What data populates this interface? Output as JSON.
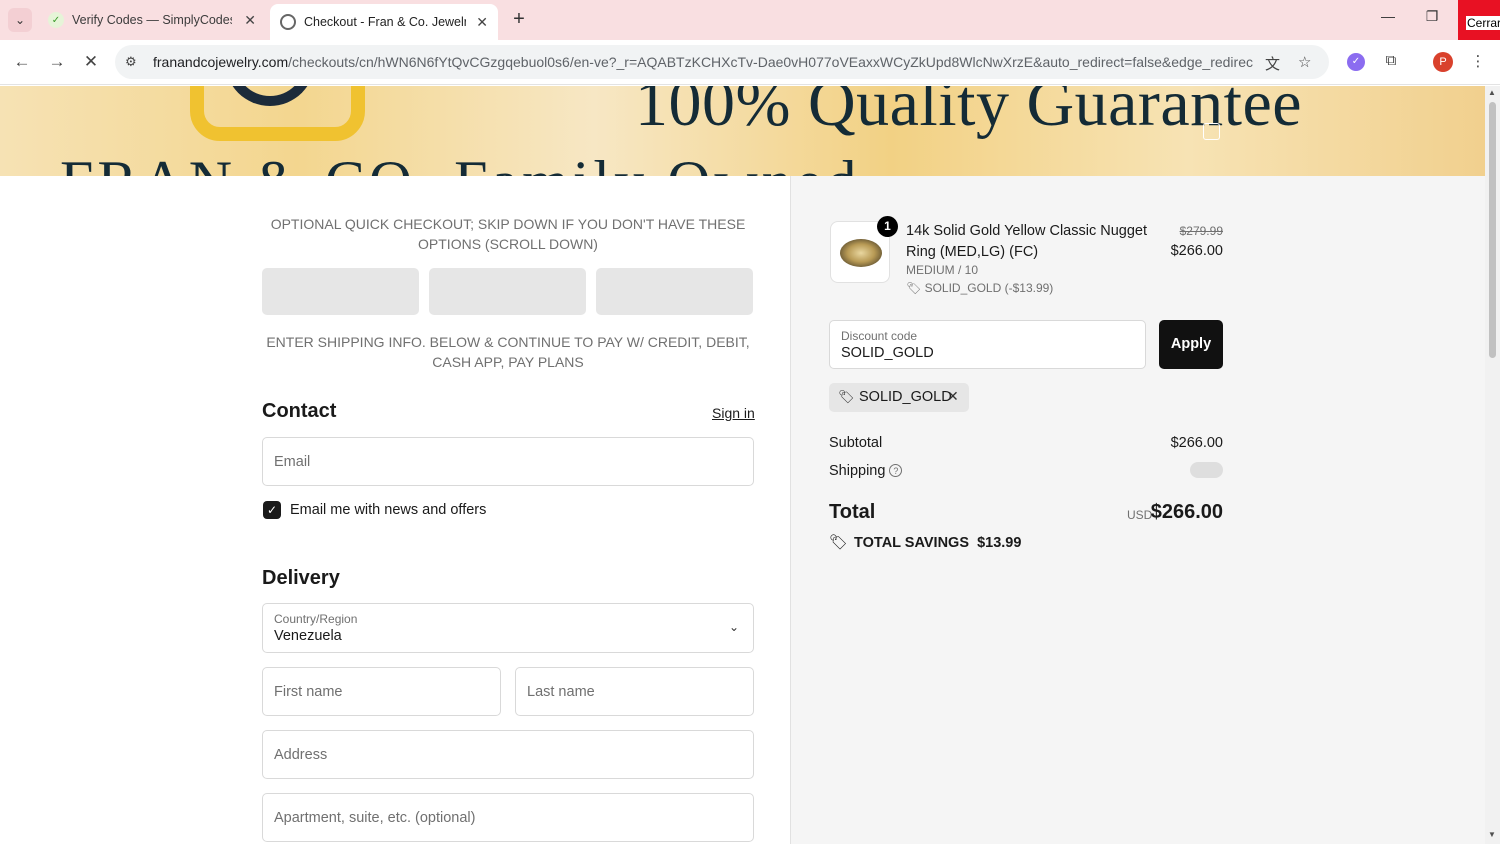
{
  "browser": {
    "tabs": [
      {
        "title": "Verify Codes — SimplyCodes",
        "close": "✕"
      },
      {
        "title": "Checkout - Fran & Co. Jewelry I",
        "close": "✕"
      }
    ],
    "new_tab": "+",
    "close_window_label": "Cerrar",
    "url_domain": "franandcojewelry.com",
    "url_path": "/checkouts/cn/hWN6N6fYtQvCGzgqebuol0s6/en-ve?_r=AQABTzKCHXcTv-Dae0vH077oVEaxxWCyZkUpd8WlcNwXrzE&auto_redirect=false&edge_redirect=true...",
    "profile_initial": "P"
  },
  "banner": {
    "headline": "100% Quality Guarantee",
    "subline": "FRAN & CO.   Family Owned"
  },
  "checkout": {
    "quick_note": "OPTIONAL QUICK CHECKOUT; SKIP DOWN IF YOU DON'T HAVE THESE OPTIONS (SCROLL DOWN)",
    "ship_note": "ENTER SHIPPING INFO. BELOW & CONTINUE TO PAY W/ CREDIT, DEBIT, CASH APP, PAY PLANS",
    "contact_title": "Contact",
    "sign_in": "Sign in",
    "email_placeholder": "Email",
    "news_label": "Email me with news and offers",
    "news_checked": true,
    "delivery_title": "Delivery",
    "country_label": "Country/Region",
    "country_value": "Venezuela",
    "first_name_placeholder": "First name",
    "last_name_placeholder": "Last name",
    "address_placeholder": "Address",
    "apartment_placeholder": "Apartment, suite, etc. (optional)"
  },
  "summary": {
    "product": {
      "quantity": "1",
      "name": "14k Solid Gold Yellow Classic Nugget Ring (MED,LG) (FC)",
      "variant": "MEDIUM / 10",
      "discount": "SOLID_GOLD (-$13.99)",
      "original_price": "$279.99",
      "price": "$266.00"
    },
    "discount_label": "Discount code",
    "discount_value": "SOLID_GOLD",
    "apply_label": "Apply",
    "applied_code": "SOLID_GOLD",
    "subtotal_label": "Subtotal",
    "subtotal_value": "$266.00",
    "shipping_label": "Shipping",
    "total_label": "Total",
    "currency": "USD",
    "total_value": "$266.00",
    "savings_label": "TOTAL SAVINGS",
    "savings_value": "$13.99"
  }
}
